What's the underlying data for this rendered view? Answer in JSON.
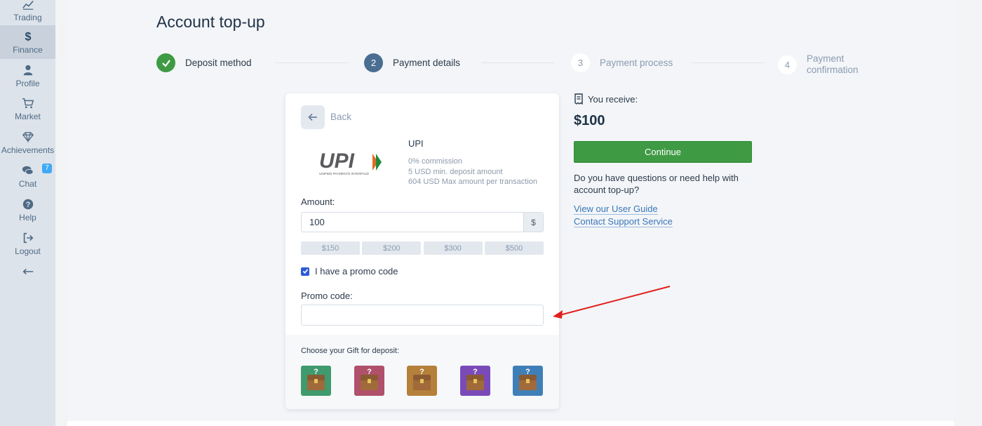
{
  "sidebar": {
    "items": [
      {
        "label": "Trading",
        "icon": "chart-line-icon"
      },
      {
        "label": "Finance",
        "icon": "dollar-icon"
      },
      {
        "label": "Profile",
        "icon": "user-icon"
      },
      {
        "label": "Market",
        "icon": "cart-icon"
      },
      {
        "label": "Achievements",
        "icon": "diamond-icon"
      },
      {
        "label": "Chat",
        "icon": "chat-icon",
        "badge": "7"
      },
      {
        "label": "Help",
        "icon": "help-icon"
      },
      {
        "label": "Logout",
        "icon": "logout-icon"
      }
    ],
    "active": "Finance",
    "collapse_icon": "arrow-left-icon"
  },
  "page": {
    "title": "Account top-up"
  },
  "stepper": {
    "steps": [
      {
        "number": "",
        "label": "Deposit method",
        "state": "done"
      },
      {
        "number": "2",
        "label": "Payment details",
        "state": "current"
      },
      {
        "number": "3",
        "label": "Payment process",
        "state": "pending"
      },
      {
        "number": "4",
        "label": "Payment\nconfirmation",
        "state": "pending"
      }
    ]
  },
  "card": {
    "back_label": "Back",
    "method": {
      "name": "UPI",
      "logo_text": "UPI",
      "logo_subtext": "UNIFIED PAYMENTS INTERFACE",
      "commission": "0% commission",
      "min_deposit": "5 USD min. deposit amount",
      "max_amount": "604 USD Max amount per transaction"
    },
    "amount_label": "Amount:",
    "amount_value": "100",
    "currency_symbol": "$",
    "presets": [
      "$150",
      "$200",
      "$300",
      "$500"
    ],
    "promo_checkbox_label": "I have a promo code",
    "promo_checked": true,
    "promo_label": "Promo code:",
    "promo_value": "",
    "gift_label": "Choose your Gift for deposit:",
    "gifts": [
      {
        "color": "#3f9a6e"
      },
      {
        "color": "#b0506a"
      },
      {
        "color": "#b5803a"
      },
      {
        "color": "#7a4bb8"
      },
      {
        "color": "#3f7fb8"
      }
    ]
  },
  "summary": {
    "receive_label": "You receive:",
    "receive_amount": "$100",
    "continue_label": "Continue",
    "help_text": "Do you have questions or need help with account top-up?",
    "links": [
      "View our User Guide",
      "Contact Support Service"
    ]
  },
  "colors": {
    "accent_green": "#3f9a44",
    "step_current": "#4a6d92",
    "link": "#3a76b8",
    "annotation_arrow": "#e0201c"
  }
}
